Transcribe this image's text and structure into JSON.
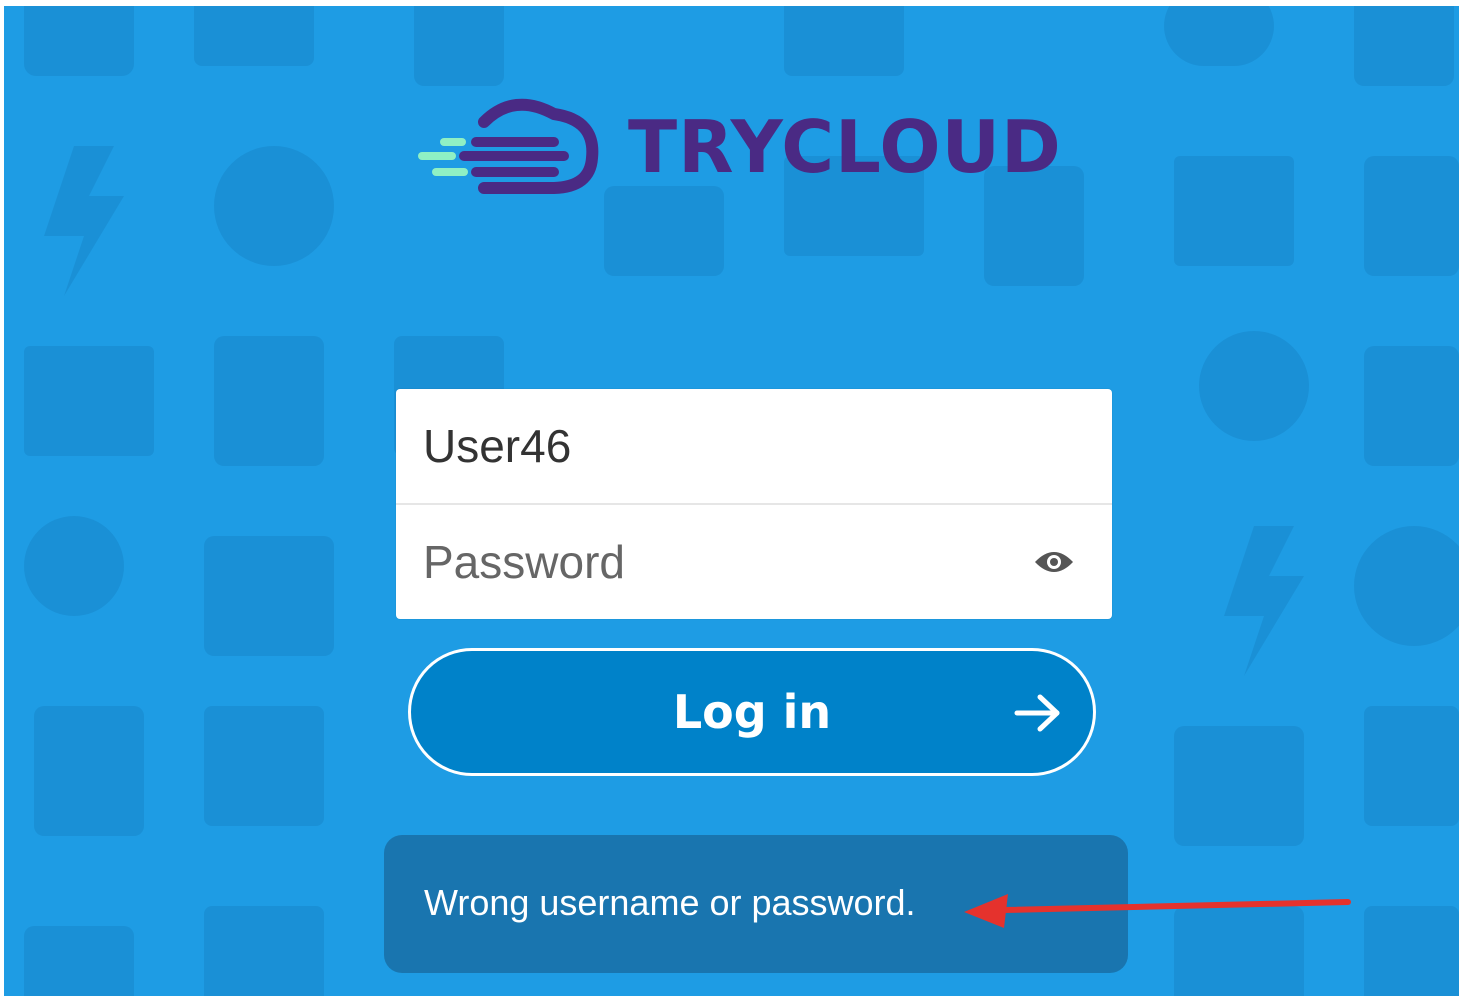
{
  "brand": {
    "name": "TRYCLOUD",
    "logo_colors": {
      "purple": "#4a2a84",
      "mint": "#8ff0c4"
    }
  },
  "login_form": {
    "username_value": "User46",
    "password_placeholder": "Password",
    "show_password_icon": "eye-icon",
    "submit_label": "Log in",
    "submit_icon": "arrow-right-icon"
  },
  "error": {
    "message": "Wrong username or password."
  },
  "annotation": {
    "icon": "red-arrow-icon",
    "color": "#e5322d"
  },
  "colors": {
    "background": "#1e9ce4",
    "button": "#0082c9"
  }
}
